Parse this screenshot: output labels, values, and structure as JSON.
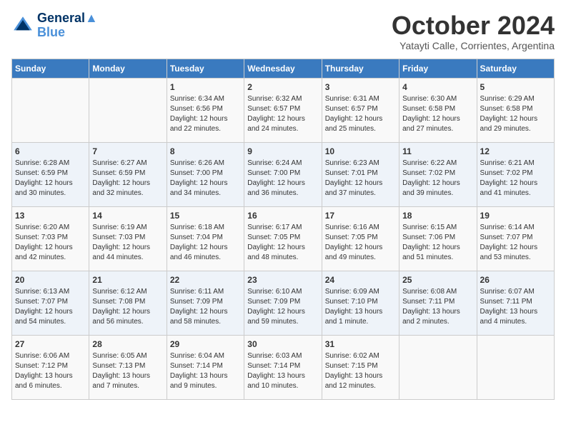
{
  "header": {
    "logo_line1": "General",
    "logo_line2": "Blue",
    "month": "October 2024",
    "location": "Yatayti Calle, Corrientes, Argentina"
  },
  "days_of_week": [
    "Sunday",
    "Monday",
    "Tuesday",
    "Wednesday",
    "Thursday",
    "Friday",
    "Saturday"
  ],
  "weeks": [
    [
      {
        "day": "",
        "content": ""
      },
      {
        "day": "",
        "content": ""
      },
      {
        "day": "1",
        "content": "Sunrise: 6:34 AM\nSunset: 6:56 PM\nDaylight: 12 hours and 22 minutes."
      },
      {
        "day": "2",
        "content": "Sunrise: 6:32 AM\nSunset: 6:57 PM\nDaylight: 12 hours and 24 minutes."
      },
      {
        "day": "3",
        "content": "Sunrise: 6:31 AM\nSunset: 6:57 PM\nDaylight: 12 hours and 25 minutes."
      },
      {
        "day": "4",
        "content": "Sunrise: 6:30 AM\nSunset: 6:58 PM\nDaylight: 12 hours and 27 minutes."
      },
      {
        "day": "5",
        "content": "Sunrise: 6:29 AM\nSunset: 6:58 PM\nDaylight: 12 hours and 29 minutes."
      }
    ],
    [
      {
        "day": "6",
        "content": "Sunrise: 6:28 AM\nSunset: 6:59 PM\nDaylight: 12 hours and 30 minutes."
      },
      {
        "day": "7",
        "content": "Sunrise: 6:27 AM\nSunset: 6:59 PM\nDaylight: 12 hours and 32 minutes."
      },
      {
        "day": "8",
        "content": "Sunrise: 6:26 AM\nSunset: 7:00 PM\nDaylight: 12 hours and 34 minutes."
      },
      {
        "day": "9",
        "content": "Sunrise: 6:24 AM\nSunset: 7:00 PM\nDaylight: 12 hours and 36 minutes."
      },
      {
        "day": "10",
        "content": "Sunrise: 6:23 AM\nSunset: 7:01 PM\nDaylight: 12 hours and 37 minutes."
      },
      {
        "day": "11",
        "content": "Sunrise: 6:22 AM\nSunset: 7:02 PM\nDaylight: 12 hours and 39 minutes."
      },
      {
        "day": "12",
        "content": "Sunrise: 6:21 AM\nSunset: 7:02 PM\nDaylight: 12 hours and 41 minutes."
      }
    ],
    [
      {
        "day": "13",
        "content": "Sunrise: 6:20 AM\nSunset: 7:03 PM\nDaylight: 12 hours and 42 minutes."
      },
      {
        "day": "14",
        "content": "Sunrise: 6:19 AM\nSunset: 7:03 PM\nDaylight: 12 hours and 44 minutes."
      },
      {
        "day": "15",
        "content": "Sunrise: 6:18 AM\nSunset: 7:04 PM\nDaylight: 12 hours and 46 minutes."
      },
      {
        "day": "16",
        "content": "Sunrise: 6:17 AM\nSunset: 7:05 PM\nDaylight: 12 hours and 48 minutes."
      },
      {
        "day": "17",
        "content": "Sunrise: 6:16 AM\nSunset: 7:05 PM\nDaylight: 12 hours and 49 minutes."
      },
      {
        "day": "18",
        "content": "Sunrise: 6:15 AM\nSunset: 7:06 PM\nDaylight: 12 hours and 51 minutes."
      },
      {
        "day": "19",
        "content": "Sunrise: 6:14 AM\nSunset: 7:07 PM\nDaylight: 12 hours and 53 minutes."
      }
    ],
    [
      {
        "day": "20",
        "content": "Sunrise: 6:13 AM\nSunset: 7:07 PM\nDaylight: 12 hours and 54 minutes."
      },
      {
        "day": "21",
        "content": "Sunrise: 6:12 AM\nSunset: 7:08 PM\nDaylight: 12 hours and 56 minutes."
      },
      {
        "day": "22",
        "content": "Sunrise: 6:11 AM\nSunset: 7:09 PM\nDaylight: 12 hours and 58 minutes."
      },
      {
        "day": "23",
        "content": "Sunrise: 6:10 AM\nSunset: 7:09 PM\nDaylight: 12 hours and 59 minutes."
      },
      {
        "day": "24",
        "content": "Sunrise: 6:09 AM\nSunset: 7:10 PM\nDaylight: 13 hours and 1 minute."
      },
      {
        "day": "25",
        "content": "Sunrise: 6:08 AM\nSunset: 7:11 PM\nDaylight: 13 hours and 2 minutes."
      },
      {
        "day": "26",
        "content": "Sunrise: 6:07 AM\nSunset: 7:11 PM\nDaylight: 13 hours and 4 minutes."
      }
    ],
    [
      {
        "day": "27",
        "content": "Sunrise: 6:06 AM\nSunset: 7:12 PM\nDaylight: 13 hours and 6 minutes."
      },
      {
        "day": "28",
        "content": "Sunrise: 6:05 AM\nSunset: 7:13 PM\nDaylight: 13 hours and 7 minutes."
      },
      {
        "day": "29",
        "content": "Sunrise: 6:04 AM\nSunset: 7:14 PM\nDaylight: 13 hours and 9 minutes."
      },
      {
        "day": "30",
        "content": "Sunrise: 6:03 AM\nSunset: 7:14 PM\nDaylight: 13 hours and 10 minutes."
      },
      {
        "day": "31",
        "content": "Sunrise: 6:02 AM\nSunset: 7:15 PM\nDaylight: 13 hours and 12 minutes."
      },
      {
        "day": "",
        "content": ""
      },
      {
        "day": "",
        "content": ""
      }
    ]
  ]
}
